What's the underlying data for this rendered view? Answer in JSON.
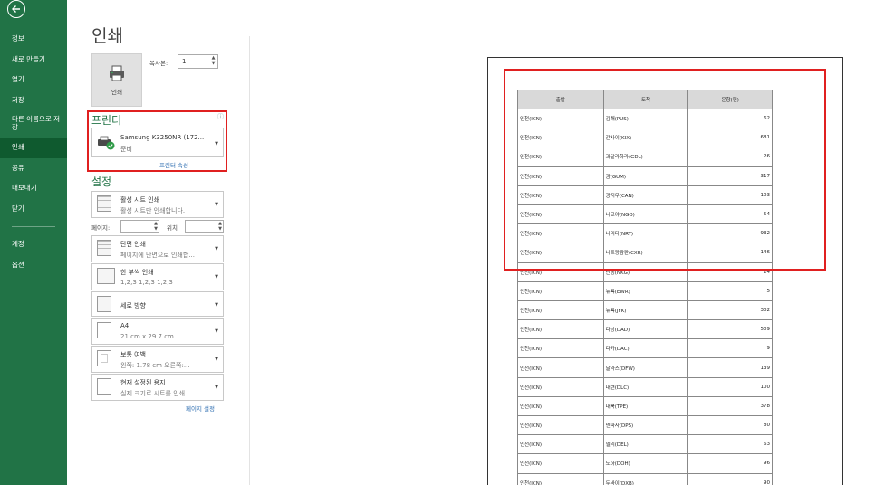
{
  "sidebar": {
    "items": [
      {
        "label": "정보"
      },
      {
        "label": "새로 만들기"
      },
      {
        "label": "열기"
      },
      {
        "label": "저장"
      },
      {
        "label": "다른 이름으로 저장"
      },
      {
        "label": "인쇄"
      },
      {
        "label": "공유"
      },
      {
        "label": "내보내기"
      },
      {
        "label": "닫기"
      },
      {
        "label": "계정"
      },
      {
        "label": "옵션"
      }
    ],
    "active": "인쇄",
    "accent_color": "#217346"
  },
  "main": {
    "title": "인쇄",
    "print_button_label": "인쇄",
    "copies_label": "복사본:",
    "copies_value": "1",
    "printer_header": "프린터",
    "printer_name": "Samsung K3250NR (172...",
    "printer_status": "준비",
    "printer_properties_link": "프린터 속성",
    "settings_header": "설정",
    "settings": [
      {
        "title": "활성 시트 인쇄",
        "subtitle": "활성 시트만 인쇄합니다.",
        "icon": "sheet-icon"
      },
      {
        "title": "단면 인쇄",
        "subtitle": "페이지에 단면으로 인쇄합...",
        "icon": "one-sided-icon"
      },
      {
        "title": "한 부씩 인쇄",
        "subtitle": "1,2,3    1,2,3    1,2,3",
        "icon": "collate-icon"
      },
      {
        "title": "세로 방향",
        "subtitle": "",
        "icon": "portrait-icon"
      },
      {
        "title": "A4",
        "subtitle": "21 cm x 29.7 cm",
        "icon": "paper-size-icon"
      },
      {
        "title": "보통 여백",
        "subtitle": "왼쪽:  1.78 cm    오른쪽:...",
        "icon": "margins-icon"
      },
      {
        "title": "현재 설정된 용지",
        "subtitle": "실제 크기로 시트를 인쇄...",
        "icon": "scaling-icon"
      }
    ],
    "pages_label": "페이지:",
    "to_label": "위치",
    "page_setup_link": "페이지 설정"
  },
  "preview": {
    "table": {
      "headers": [
        "출발",
        "도착",
        "운항(편)"
      ],
      "rows": [
        [
          "인천(ICN)",
          "김해(PUS)",
          "62"
        ],
        [
          "인천(ICN)",
          "간사이(KIX)",
          "681"
        ],
        [
          "인천(ICN)",
          "과달라하라(GDL)",
          "26"
        ],
        [
          "인천(ICN)",
          "괌(GUM)",
          "317"
        ],
        [
          "인천(ICN)",
          "광저우(CAN)",
          "103"
        ],
        [
          "인천(ICN)",
          "나고야(NGO)",
          "54"
        ],
        [
          "인천(ICN)",
          "나리타(NRT)",
          "932"
        ],
        [
          "인천(ICN)",
          "나트랑깜란(CXR)",
          "146"
        ],
        [
          "인천(ICN)",
          "난징(NKG)",
          "24"
        ],
        [
          "인천(ICN)",
          "뉴욕(EWR)",
          "5"
        ],
        [
          "인천(ICN)",
          "뉴욕(JFK)",
          "302"
        ],
        [
          "인천(ICN)",
          "다낭(DAD)",
          "509"
        ],
        [
          "인천(ICN)",
          "다카(DAC)",
          "9"
        ],
        [
          "인천(ICN)",
          "달라스(DFW)",
          "139"
        ],
        [
          "인천(ICN)",
          "대련(DLC)",
          "100"
        ],
        [
          "인천(ICN)",
          "대북(TPE)",
          "378"
        ],
        [
          "인천(ICN)",
          "덴파사(DPS)",
          "80"
        ],
        [
          "인천(ICN)",
          "델리(DEL)",
          "63"
        ],
        [
          "인천(ICN)",
          "도하(DOH)",
          "96"
        ],
        [
          "인천(ICN)",
          "두바이(DXB)",
          "90"
        ]
      ]
    }
  },
  "colors": {
    "highlight_box": "#e02020",
    "link": "#2b6cb0"
  }
}
